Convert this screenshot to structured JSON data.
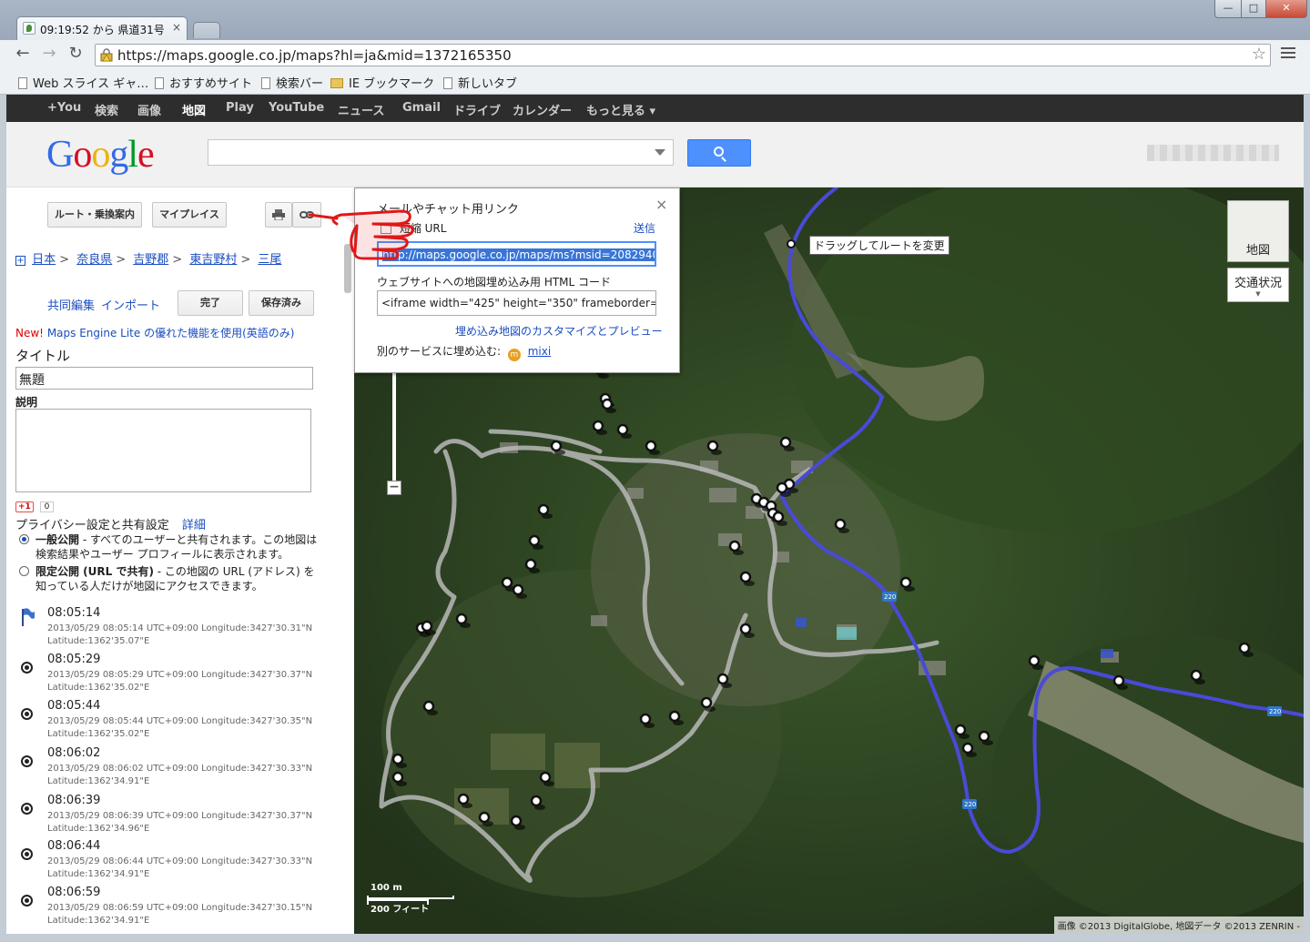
{
  "browser": {
    "tab_title": "09:19:52 から 県道31号",
    "tab_close": "×",
    "url": "https://maps.google.co.jp/maps?hl=ja&mid=1372165350",
    "bookmarks": [
      "Web スライス ギャ…",
      "おすすめサイト",
      "検索バー",
      "IE ブックマーク",
      "新しいタブ"
    ],
    "window_buttons": {
      "minimize": "—",
      "maximize": "□",
      "close": "✕"
    }
  },
  "gbar": {
    "items": [
      "+You",
      "検索",
      "画像",
      "地図",
      "Play",
      "YouTube",
      "ニュース",
      "Gmail",
      "ドライブ",
      "カレンダー",
      "もっと見る ▾"
    ],
    "active": "地図"
  },
  "header": {
    "logo": "Google"
  },
  "panel": {
    "route_button": "ルート・乗換案内",
    "myplaces_button": "マイプレイス",
    "breadcrumb": [
      "日本",
      "奈良県",
      "吉野郡",
      "東吉野村",
      "三尾"
    ],
    "breadcrumb_sep": ">",
    "collab_link": "共同編集",
    "import_link": "インポート",
    "done_button": "完了",
    "saved_button": "保存済み",
    "new_label": "New!",
    "new_text": "Maps Engine Lite の優れた機能を使用(英語のみ)",
    "title_label": "タイトル",
    "title_value": "無題",
    "desc_label": "説明",
    "plusone": "+1",
    "plusone_count": "0",
    "privacy_label": "プライバシー設定と共有設定",
    "privacy_details": "詳細",
    "privacy_public_title": "一般公開",
    "privacy_public_text": " - すべてのユーザーと共有されます。この地図は検索結果やユーザー プロフィールに表示されます。",
    "privacy_limited_title": "限定公開 (URL で共有)",
    "privacy_limited_text": " - この地図の URL (アドレス) を知っている人だけが地図にアクセスできます。",
    "track": [
      {
        "time": "08:05:14",
        "line1": "2013/05/29 08:05:14 UTC+09:00 Longitude:3427'30.31\"N",
        "line2": "Latitude:1362'35.07\"E"
      },
      {
        "time": "08:05:29",
        "line1": "2013/05/29 08:05:29 UTC+09:00 Longitude:3427'30.37\"N",
        "line2": "Latitude:1362'35.02\"E"
      },
      {
        "time": "08:05:44",
        "line1": "2013/05/29 08:05:44 UTC+09:00 Longitude:3427'30.35\"N",
        "line2": "Latitude:1362'35.02\"E"
      },
      {
        "time": "08:06:02",
        "line1": "2013/05/29 08:06:02 UTC+09:00 Longitude:3427'30.33\"N",
        "line2": "Latitude:1362'34.91\"E"
      },
      {
        "time": "08:06:39",
        "line1": "2013/05/29 08:06:39 UTC+09:00 Longitude:3427'30.37\"N",
        "line2": "Latitude:1362'34.96\"E"
      },
      {
        "time": "08:06:44",
        "line1": "2013/05/29 08:06:44 UTC+09:00 Longitude:3427'30.33\"N",
        "line2": "Latitude:1362'34.91\"E"
      },
      {
        "time": "08:06:59",
        "line1": "2013/05/29 08:06:59 UTC+09:00 Longitude:3427'30.15\"N",
        "line2": "Latitude:1362'34.91\"E"
      }
    ]
  },
  "popup": {
    "title": "メールやチャット用リンク",
    "close": "×",
    "short_url_label": "短縮 URL",
    "send_link": "送信",
    "link_value": "http://maps.google.co.jp/maps/ms?msid=2082940",
    "embed_label": "ウェブサイトへの地図埋め込み用 HTML コード",
    "embed_value": "<iframe width=\"425\" height=\"350\" frameborder=\"0\" s",
    "customize_link": "埋め込み地図のカスタマイズとプレビュー",
    "other_services_label": "別のサービスに埋め込む:",
    "mixi_link": "mixi"
  },
  "map": {
    "map_type_button": "地図",
    "traffic_button": "交通状況",
    "drag_tooltip": "ドラッグしてルートを変更",
    "scale_metric": "100 m",
    "scale_imperial": "200 フィート",
    "route_shield": "220",
    "copyright": "画像 ©2013 DigitalGlobe, 地図データ ©2013 ZENRIN -"
  },
  "colors": {
    "route_blue": "#4a4ad8",
    "track_gray": "#b8b8b8",
    "link_blue": "#1a4dc0",
    "search_blue": "#4d90fe",
    "gbar_bg": "#2d2d2d"
  }
}
